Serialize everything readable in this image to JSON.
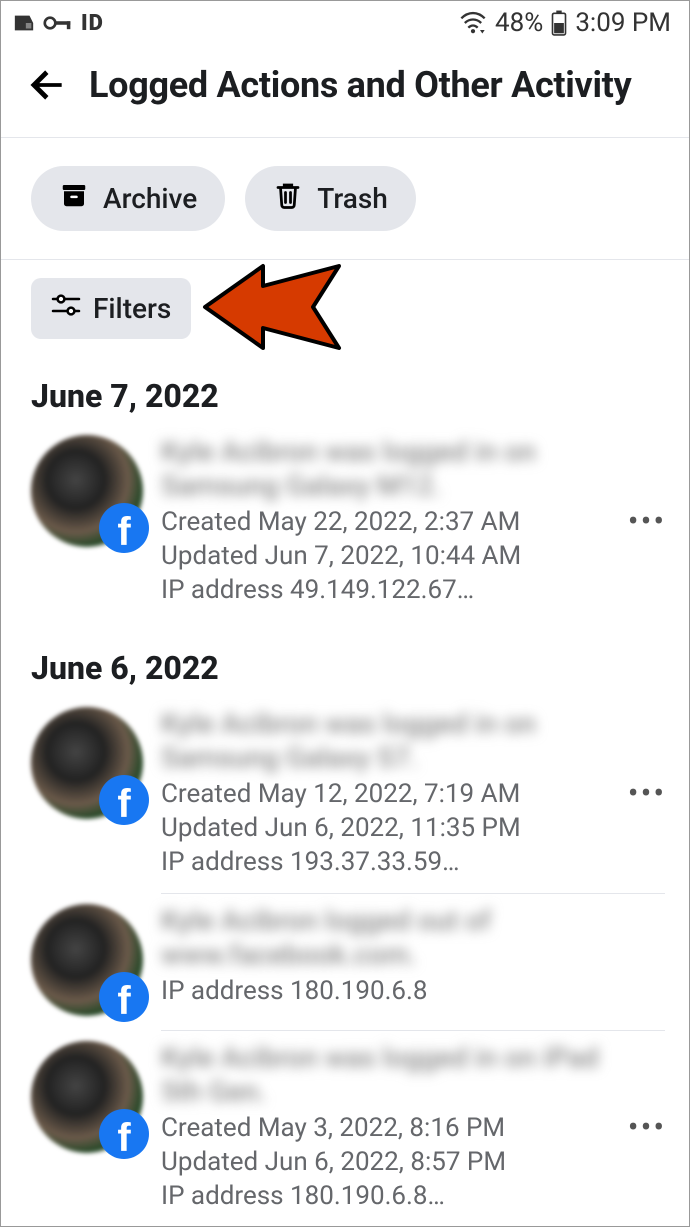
{
  "status": {
    "battery_pct": "48%",
    "time": "3:09 PM"
  },
  "header": {
    "title": "Logged Actions and Other Activity"
  },
  "actions": {
    "archive": "Archive",
    "trash": "Trash"
  },
  "filters": {
    "label": "Filters"
  },
  "sections": [
    {
      "date": "June 7, 2022",
      "entries": [
        {
          "title_blur": "Kyle Acibron was logged in on Samsung Galaxy M12.",
          "created": "Created May 22, 2022, 2:37 AM",
          "updated": "Updated Jun 7, 2022, 10:44 AM",
          "ip": "IP address 49.149.122.67…",
          "has_more": true
        }
      ]
    },
    {
      "date": "June 6, 2022",
      "entries": [
        {
          "title_blur": "Kyle Acibron was logged in on Samsung Galaxy S7.",
          "created": "Created May 12, 2022, 7:19 AM",
          "updated": "Updated Jun 6, 2022, 11:35 PM",
          "ip": "IP address 193.37.33.59…",
          "has_more": true
        },
        {
          "title_blur": "Kyle Acibron logged out of www.facebook.com.",
          "created": "",
          "updated": "",
          "ip": "IP address 180.190.6.8",
          "has_more": false
        },
        {
          "title_blur": "Kyle Acibron was logged in on iPad 5th Gen.",
          "created": "Created May 3, 2022, 8:16 PM",
          "updated": "Updated Jun 6, 2022, 8:57 PM",
          "ip": "IP address 180.190.6.8…",
          "has_more": true
        }
      ]
    }
  ]
}
